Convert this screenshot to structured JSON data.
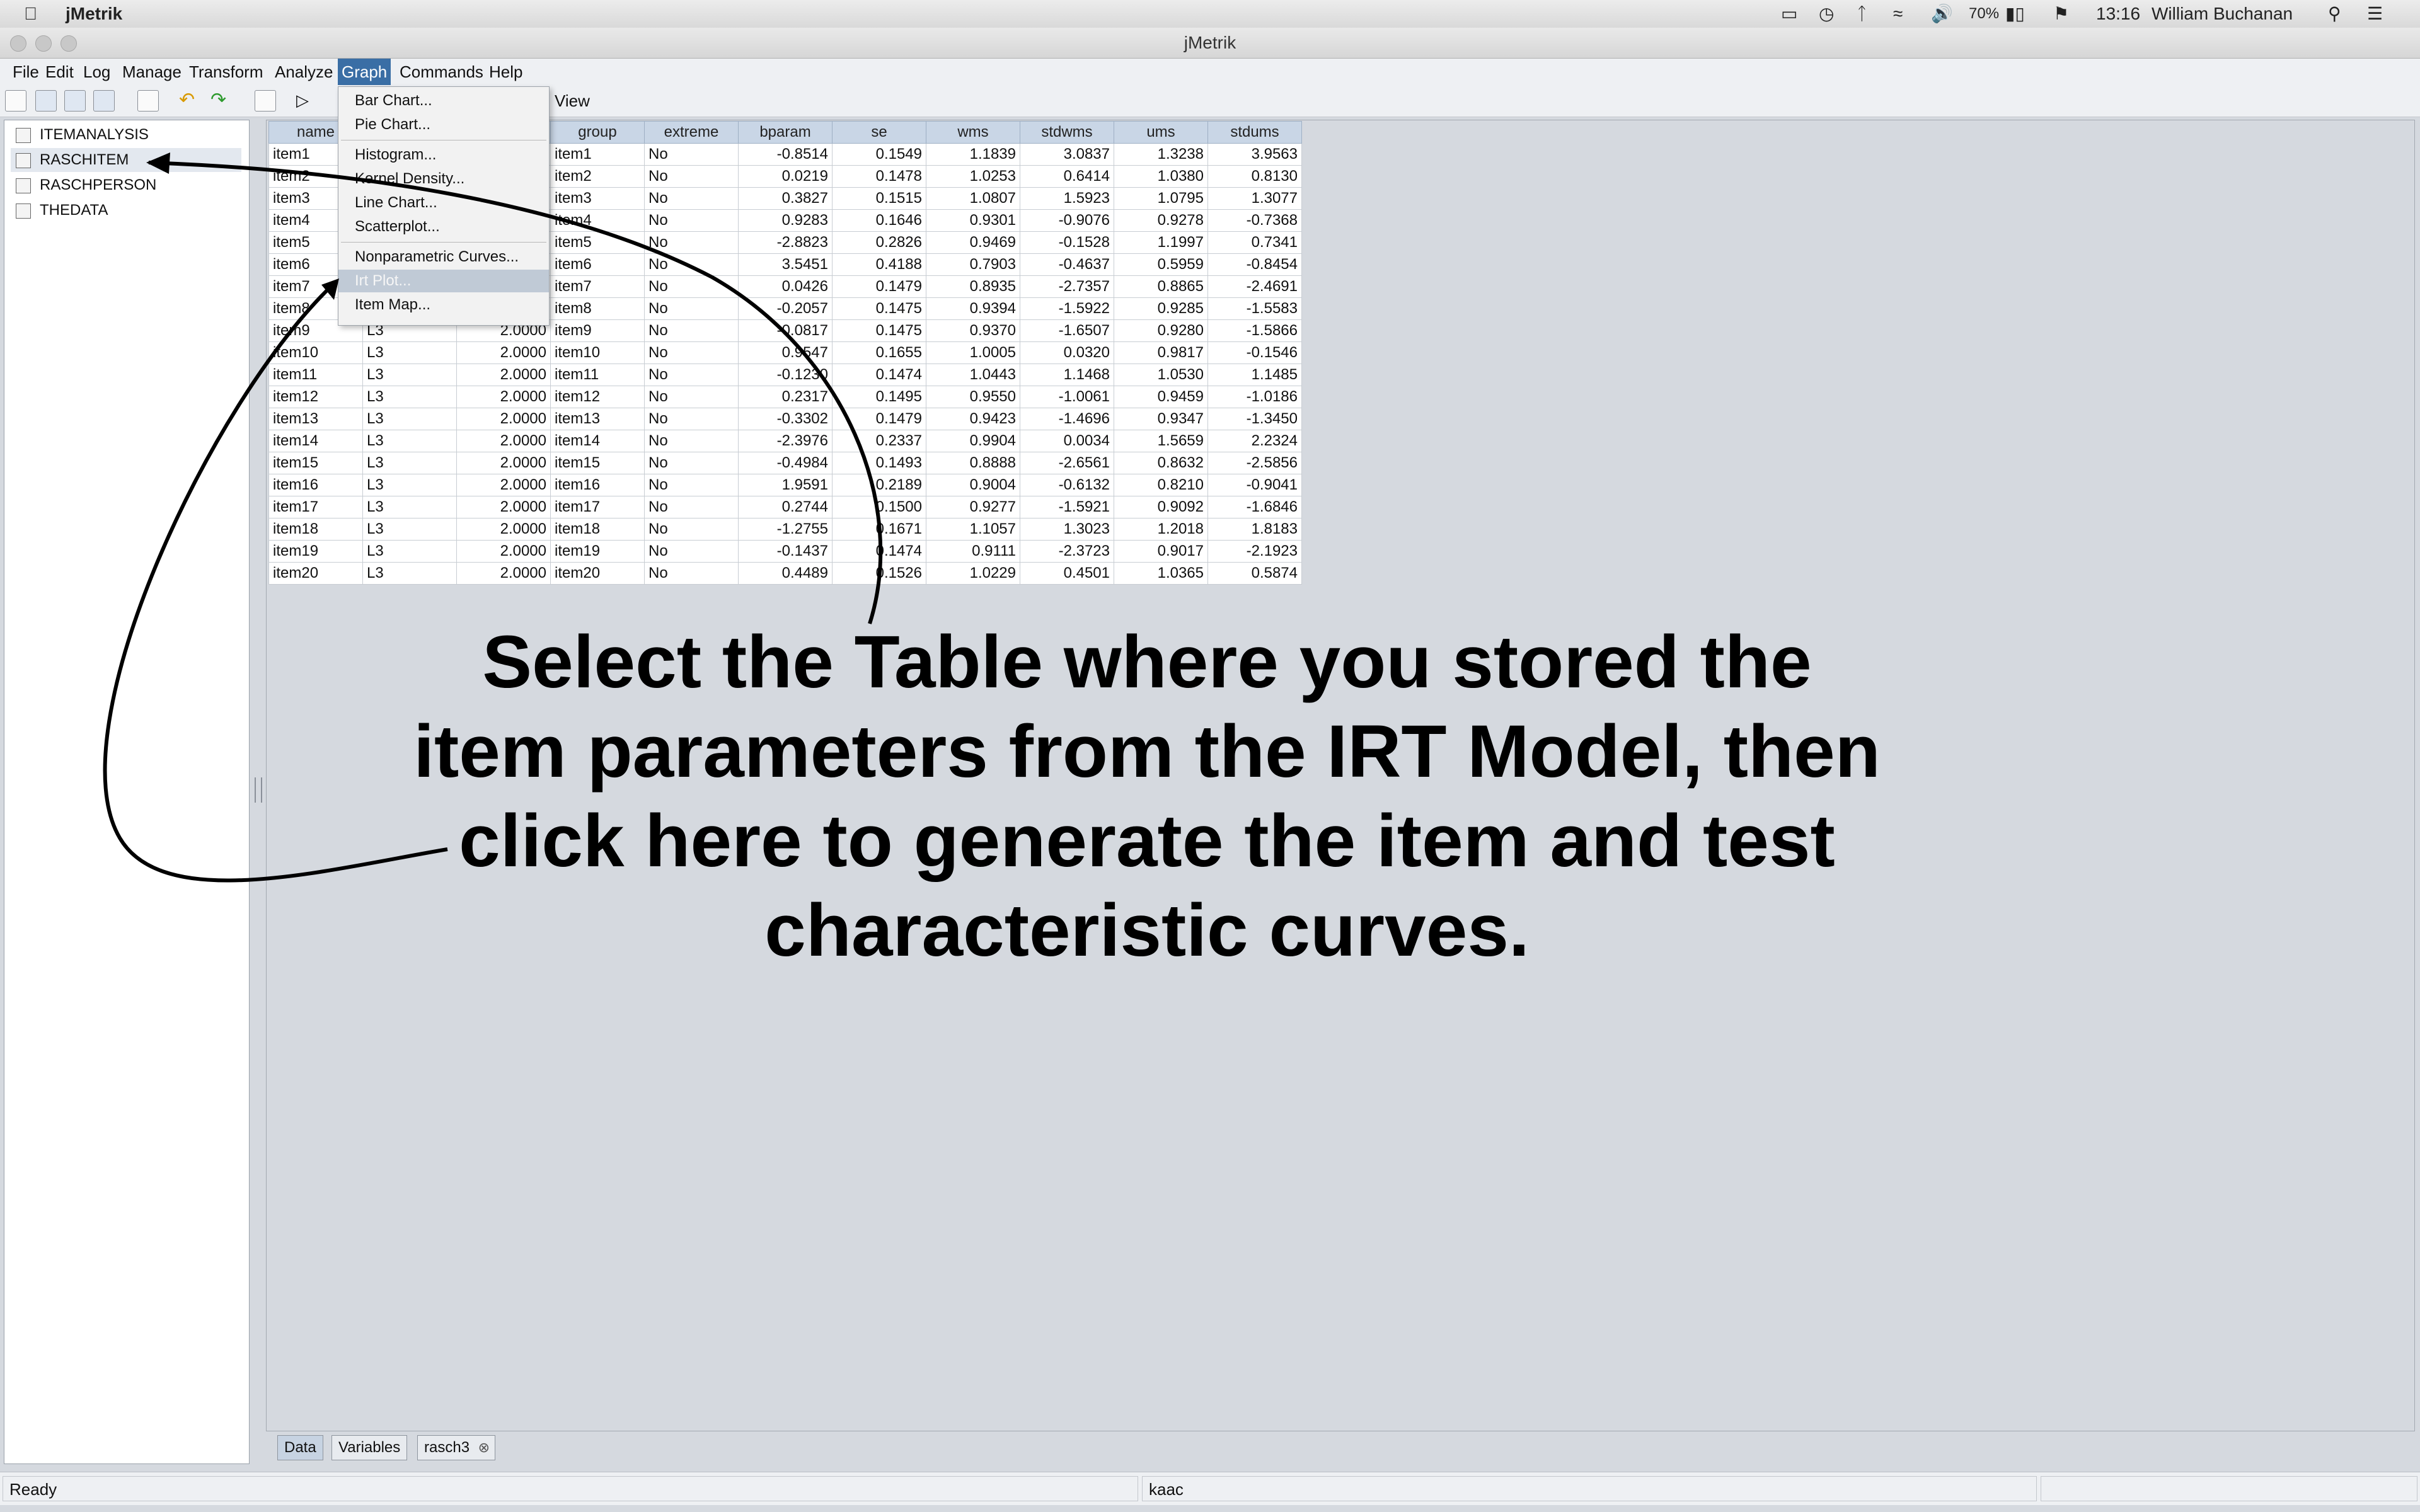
{
  "macbar": {
    "app_name": "jMetrik",
    "battery": "70%",
    "time": "13:16",
    "user": "William Buchanan"
  },
  "window": {
    "title": "jMetrik"
  },
  "menubar": [
    "File",
    "Edit",
    "Log",
    "Manage",
    "Transform",
    "Analyze",
    "Graph",
    "Commands",
    "Help"
  ],
  "toolbar": {
    "view_label": "View"
  },
  "sidebar": {
    "items": [
      {
        "label": "ITEMANALYSIS"
      },
      {
        "label": "RASCHITEM"
      },
      {
        "label": "RASCHPERSON"
      },
      {
        "label": "THEDATA"
      }
    ]
  },
  "graph_menu": {
    "items": [
      "Bar Chart...",
      "Pie Chart...",
      "Histogram...",
      "Kernel Density...",
      "Line Chart...",
      "Scatterplot...",
      "Nonparametric Curves...",
      "Irt Plot...",
      "Item Map..."
    ],
    "highlighted": "Irt Plot..."
  },
  "table": {
    "columns": [
      "name",
      "",
      "",
      "group",
      "extreme",
      "bparam",
      "se",
      "wms",
      "stdwms",
      "ums",
      "stdums"
    ],
    "rows": [
      [
        "item1",
        "",
        "",
        "item1",
        "No",
        "-0.8514",
        "0.1549",
        "1.1839",
        "3.0837",
        "1.3238",
        "3.9563"
      ],
      [
        "item2",
        "",
        "",
        "item2",
        "No",
        "0.0219",
        "0.1478",
        "1.0253",
        "0.6414",
        "1.0380",
        "0.8130"
      ],
      [
        "item3",
        "",
        "",
        "item3",
        "No",
        "0.3827",
        "0.1515",
        "1.0807",
        "1.5923",
        "1.0795",
        "1.3077"
      ],
      [
        "item4",
        "",
        "",
        "item4",
        "No",
        "0.9283",
        "0.1646",
        "0.9301",
        "-0.9076",
        "0.9278",
        "-0.7368"
      ],
      [
        "item5",
        "",
        "",
        "item5",
        "No",
        "-2.8823",
        "0.2826",
        "0.9469",
        "-0.1528",
        "1.1997",
        "0.7341"
      ],
      [
        "item6",
        "",
        "",
        "item6",
        "No",
        "3.5451",
        "0.4188",
        "0.7903",
        "-0.4637",
        "0.5959",
        "-0.8454"
      ],
      [
        "item7",
        "",
        "",
        "item7",
        "No",
        "0.0426",
        "0.1479",
        "0.8935",
        "-2.7357",
        "0.8865",
        "-2.4691"
      ],
      [
        "item8",
        "",
        "",
        "item8",
        "No",
        "-0.2057",
        "0.1475",
        "0.9394",
        "-1.5922",
        "0.9285",
        "-1.5583"
      ],
      [
        "item9",
        "L3",
        "2.0000",
        "item9",
        "No",
        "-0.0817",
        "0.1475",
        "0.9370",
        "-1.6507",
        "0.9280",
        "-1.5866"
      ],
      [
        "item10",
        "L3",
        "2.0000",
        "item10",
        "No",
        "0.9547",
        "0.1655",
        "1.0005",
        "0.0320",
        "0.9817",
        "-0.1546"
      ],
      [
        "item11",
        "L3",
        "2.0000",
        "item11",
        "No",
        "-0.1230",
        "0.1474",
        "1.0443",
        "1.1468",
        "1.0530",
        "1.1485"
      ],
      [
        "item12",
        "L3",
        "2.0000",
        "item12",
        "No",
        "0.2317",
        "0.1495",
        "0.9550",
        "-1.0061",
        "0.9459",
        "-1.0186"
      ],
      [
        "item13",
        "L3",
        "2.0000",
        "item13",
        "No",
        "-0.3302",
        "0.1479",
        "0.9423",
        "-1.4696",
        "0.9347",
        "-1.3450"
      ],
      [
        "item14",
        "L3",
        "2.0000",
        "item14",
        "No",
        "-2.3976",
        "0.2337",
        "0.9904",
        "0.0034",
        "1.5659",
        "2.2324"
      ],
      [
        "item15",
        "L3",
        "2.0000",
        "item15",
        "No",
        "-0.4984",
        "0.1493",
        "0.8888",
        "-2.6561",
        "0.8632",
        "-2.5856"
      ],
      [
        "item16",
        "L3",
        "2.0000",
        "item16",
        "No",
        "1.9591",
        "0.2189",
        "0.9004",
        "-0.6132",
        "0.8210",
        "-0.9041"
      ],
      [
        "item17",
        "L3",
        "2.0000",
        "item17",
        "No",
        "0.2744",
        "0.1500",
        "0.9277",
        "-1.5921",
        "0.9092",
        "-1.6846"
      ],
      [
        "item18",
        "L3",
        "2.0000",
        "item18",
        "No",
        "-1.2755",
        "0.1671",
        "1.1057",
        "1.3023",
        "1.2018",
        "1.8183"
      ],
      [
        "item19",
        "L3",
        "2.0000",
        "item19",
        "No",
        "-0.1437",
        "0.1474",
        "0.9111",
        "-2.3723",
        "0.9017",
        "-2.1923"
      ],
      [
        "item20",
        "L3",
        "2.0000",
        "item20",
        "No",
        "0.4489",
        "0.1526",
        "1.0229",
        "0.4501",
        "1.0365",
        "0.5874"
      ]
    ]
  },
  "annotation": {
    "lines": [
      "Select the Table where you stored the",
      "item parameters from the IRT Model, then",
      "click here to generate the item and test",
      "characteristic curves."
    ]
  },
  "bottom_tabs": [
    "Data",
    "Variables",
    "rasch3"
  ],
  "status": {
    "left": "Ready",
    "middle": "kaac"
  }
}
